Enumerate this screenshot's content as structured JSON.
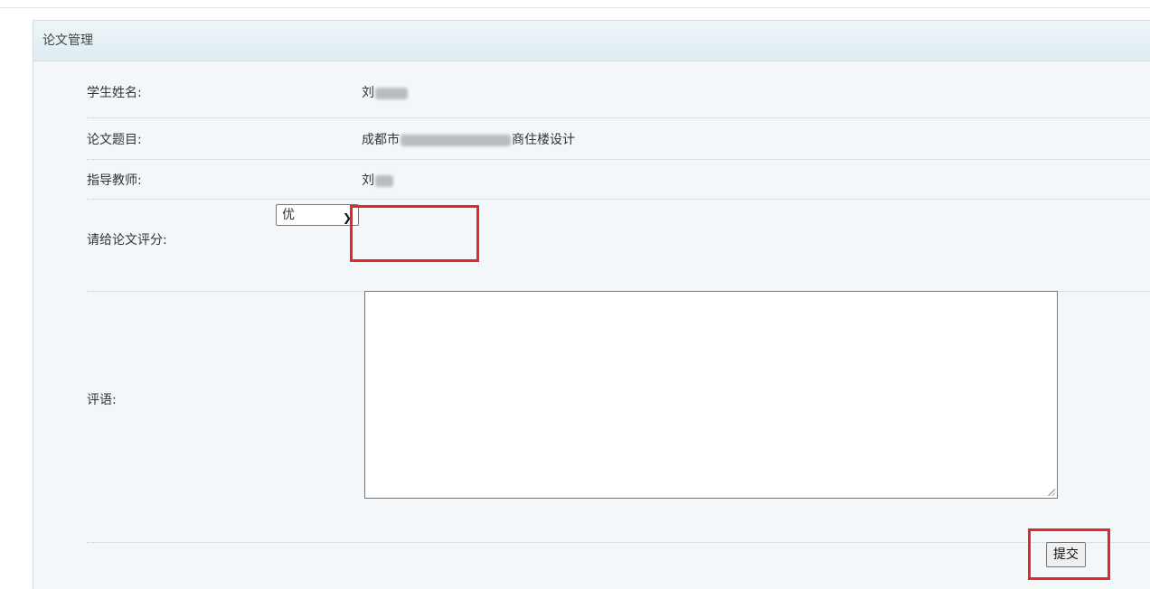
{
  "panel": {
    "title": "论文管理"
  },
  "form": {
    "student_name_label": "学生姓名:",
    "student_name_value_visible": "刘",
    "thesis_title_label": "论文题目:",
    "thesis_title_prefix": "成都市",
    "thesis_title_suffix": "商住楼设计",
    "advisor_label": "指导教师:",
    "advisor_value_visible": "刘",
    "grade_label": "请给论文评分:",
    "grade_selected": "优",
    "comment_label": "评语:",
    "comment_value": "",
    "submit_label": "提交"
  },
  "highlight_color": "#e0282e"
}
